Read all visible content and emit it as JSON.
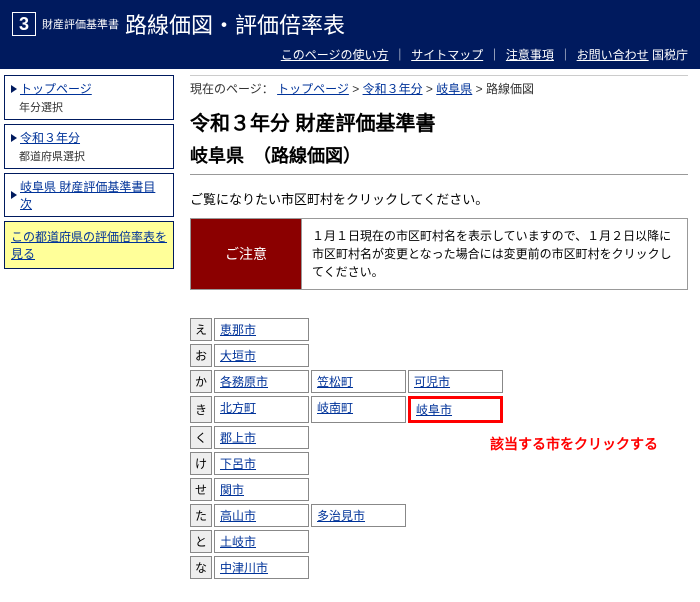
{
  "header": {
    "logo_num": "3",
    "logo_sub": "財産評価基準書",
    "site_title": "路線価図・評価倍率表",
    "links": {
      "usage": "このページの使い方",
      "sitemap": "サイトマップ",
      "caution": "注意事項",
      "contact": "お問い合わせ",
      "nta": "国税庁"
    }
  },
  "sidebar": {
    "items": [
      {
        "link": "トップページ",
        "sub": "年分選択"
      },
      {
        "link": "令和３年分",
        "sub": "都道府県選択"
      },
      {
        "link": "岐阜県 財産評価基準書目次",
        "sub": ""
      }
    ],
    "yellow": "この都道府県の評価倍率表を見る"
  },
  "breadcrumb": {
    "label": "現在のページ：",
    "top": "トップページ",
    "year": "令和３年分",
    "pref": "岐阜県",
    "current": "路線価図"
  },
  "main": {
    "title": "令和３年分 財産評価基準書",
    "sub": "岐阜県　（路線価図）",
    "intro": "ご覧になりたい市区町村をクリックしてください。",
    "notice_label": "ご注意",
    "notice_text": "１月１日現在の市区町村名を表示していますので、１月２日以降に市区町村名が変更となった場合には変更前の市区町村をクリックしてください。"
  },
  "rows": [
    {
      "kana": "え",
      "cells": [
        "恵那市"
      ]
    },
    {
      "kana": "お",
      "cells": [
        "大垣市"
      ]
    },
    {
      "kana": "か",
      "cells": [
        "各務原市",
        "笠松町",
        "可児市"
      ]
    },
    {
      "kana": "き",
      "cells": [
        "北方町",
        "岐南町",
        "岐阜市"
      ],
      "highlight_index": 2
    },
    {
      "kana": "く",
      "cells": [
        "郡上市"
      ]
    },
    {
      "kana": "け",
      "cells": [
        "下呂市"
      ]
    },
    {
      "kana": "せ",
      "cells": [
        "関市"
      ]
    },
    {
      "kana": "た",
      "cells": [
        "高山市",
        "多治見市"
      ]
    },
    {
      "kana": "と",
      "cells": [
        "土岐市"
      ]
    },
    {
      "kana": "な",
      "cells": [
        "中津川市"
      ]
    }
  ],
  "callout": "該当する市をクリックする"
}
